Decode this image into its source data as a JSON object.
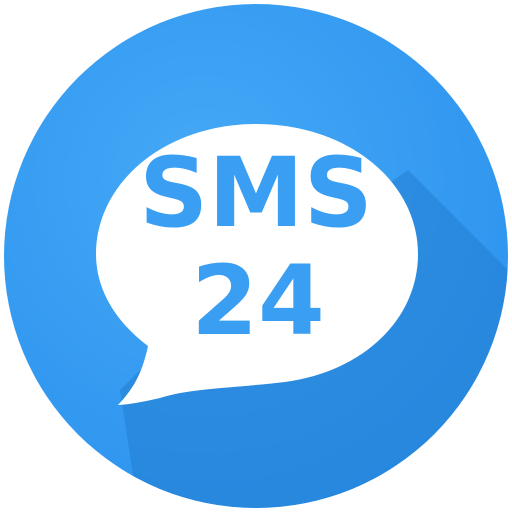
{
  "app_icon": {
    "line1": "SMS",
    "line2": "24"
  },
  "colors": {
    "background_circle": "#2f9af3",
    "long_shadow": "#1f77c9",
    "bubble": "#ffffff",
    "text_fill": "#3a9ef2",
    "text_inline": "#ffffff"
  },
  "icon_names": {
    "bubble": "speech-bubble-icon"
  }
}
